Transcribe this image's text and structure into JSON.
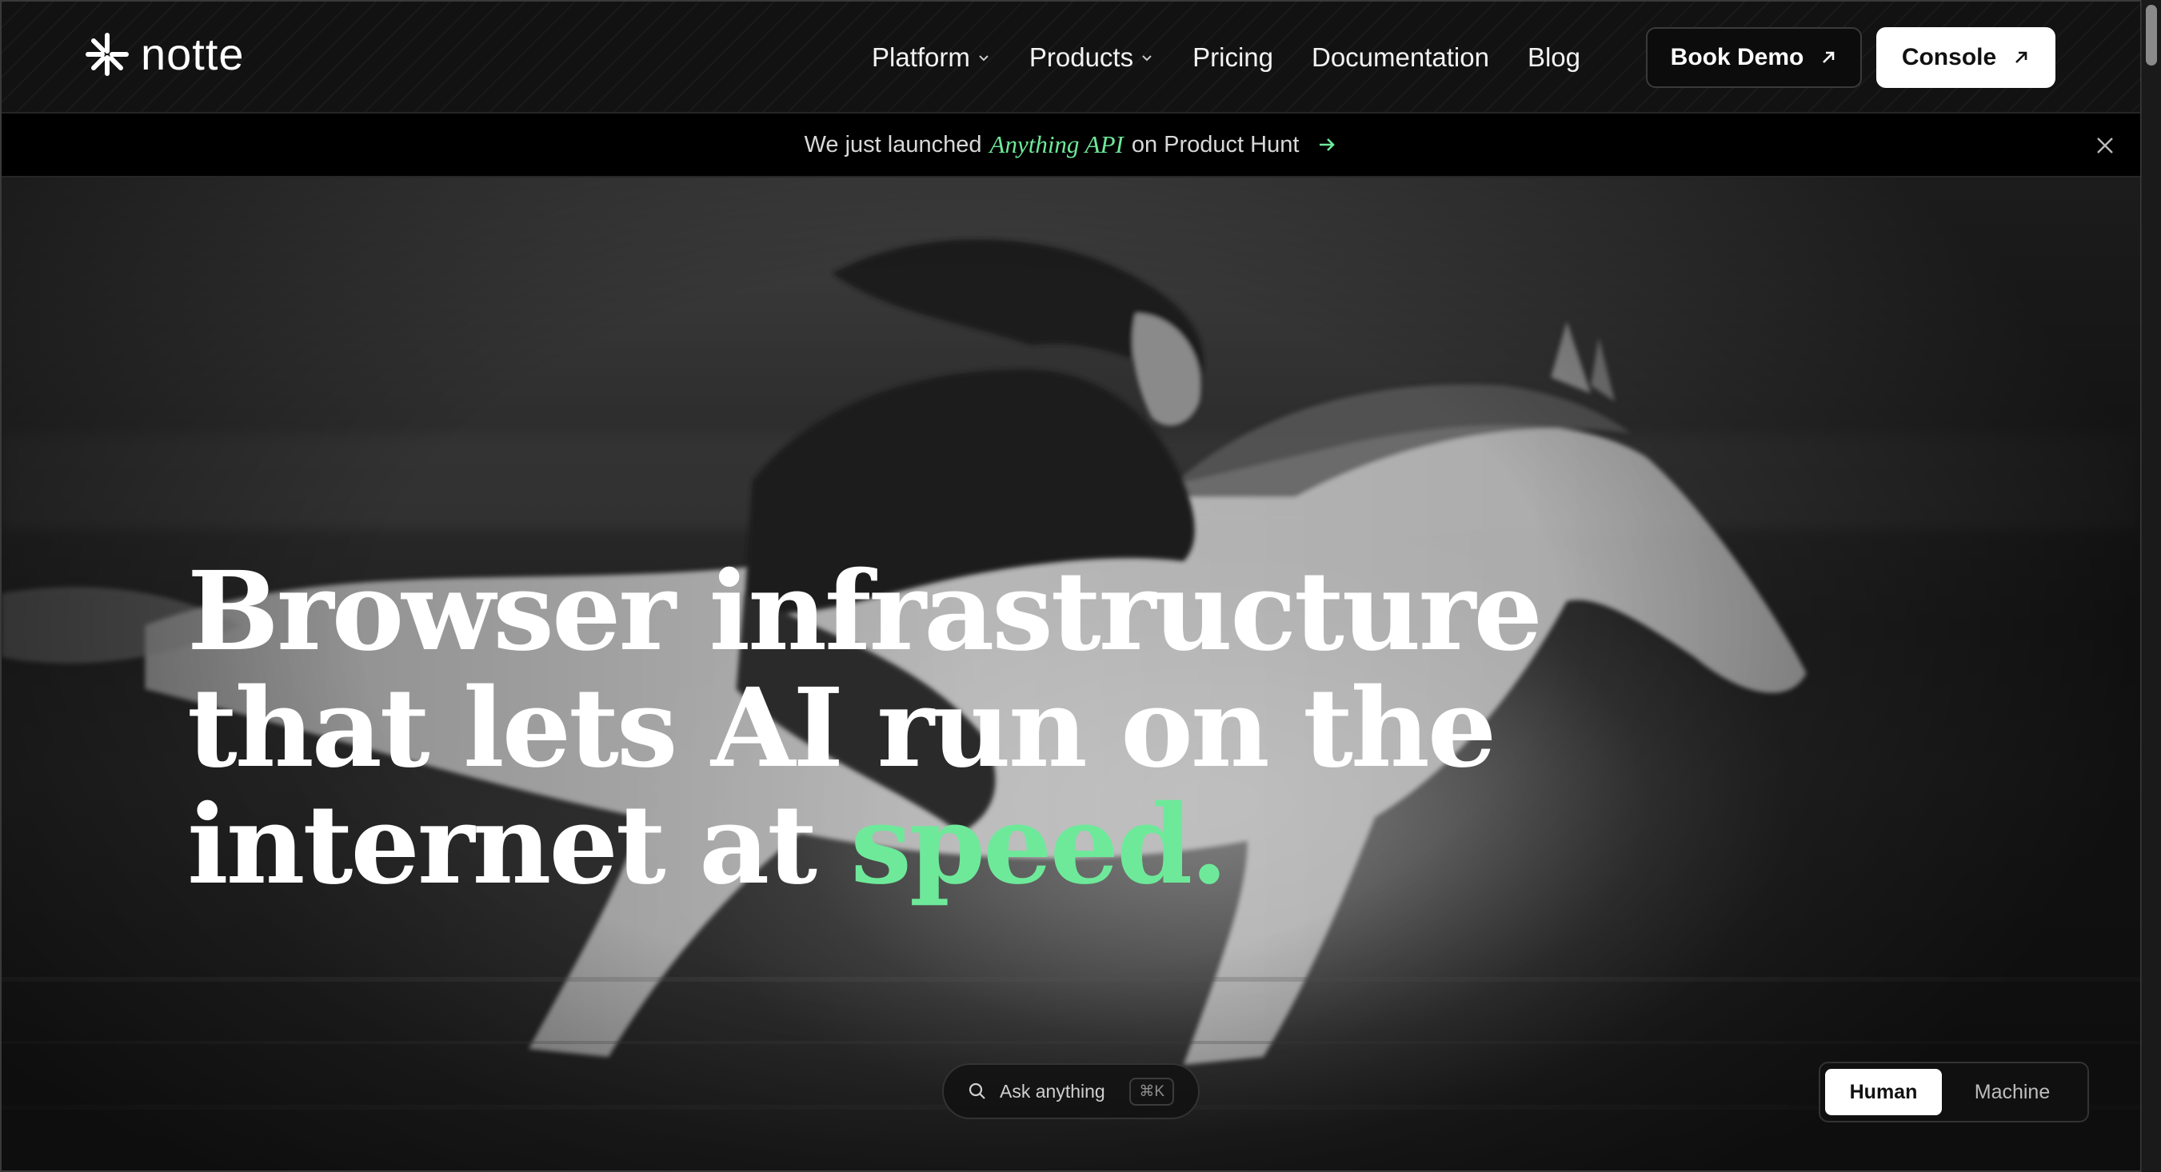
{
  "brand": {
    "name": "notte",
    "icon": "notte-asterisk-logo-icon"
  },
  "nav": {
    "items": [
      {
        "label": "Platform",
        "has_dropdown": true
      },
      {
        "label": "Products",
        "has_dropdown": true
      },
      {
        "label": "Pricing",
        "has_dropdown": false
      },
      {
        "label": "Documentation",
        "has_dropdown": false
      },
      {
        "label": "Blog",
        "has_dropdown": false
      }
    ],
    "book_demo": "Book Demo",
    "console": "Console"
  },
  "announcement": {
    "prefix": "We just launched",
    "highlight": "Anything API",
    "suffix": "on Product Hunt",
    "icon": "arrow-right-icon",
    "close_icon": "close-icon"
  },
  "hero": {
    "headline_line1": "Browser infrastructure",
    "headline_line2": "that lets AI run on the",
    "headline_line3_prefix": "internet at",
    "headline_accent": "speed.",
    "image": "black-and-white photo of a woman riding a galloping white horse"
  },
  "ask": {
    "label": "Ask anything",
    "shortcut": "⌘K",
    "icon": "search-icon"
  },
  "mode_toggle": {
    "options": [
      "Human",
      "Machine"
    ],
    "selected": "Human"
  },
  "colors": {
    "accent": "#6ee99a",
    "background": "#0b0b0b",
    "button_light": "#ffffff"
  }
}
